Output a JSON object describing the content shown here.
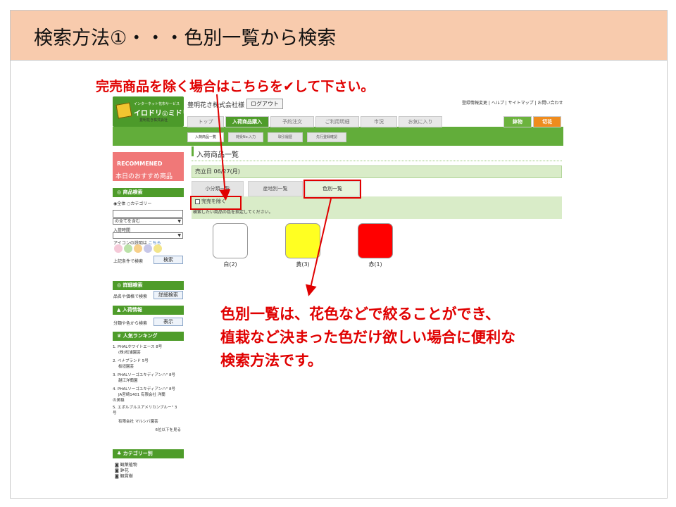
{
  "slide": {
    "title": "検索方法①・・・色別一覧から検索",
    "callout_top": "完売商品を除く場合はこちらを✔して下さい。",
    "callout_bottom_lines": [
      "色別一覧は、花色などで絞ることができ、",
      "植栽など決まった色だけ欲しい場合に便利な",
      "検索方法です。"
    ]
  },
  "header": {
    "logo_line1": "インターネット花市サービス",
    "logo_line2": "イロドリ◎ミドリ",
    "logo_line3": "豊明花き株式会社",
    "user": "豊明花き株式会社様",
    "logout": "ログアウト",
    "links": "登録情報変更 | ヘルプ | サイトマップ | お問い合わせ"
  },
  "nav": {
    "tabs": [
      "トップ",
      "入荷商品購入",
      "予約注文",
      "ご利用明細",
      "市況",
      "お気に入り"
    ],
    "right_tabs": [
      "鉢物",
      "切花"
    ]
  },
  "subnav": {
    "tabs": [
      "入荷商品一覧",
      "荷受No.入力",
      "取引履歴",
      "先行登録確認"
    ]
  },
  "sidebar": {
    "reco_top": "RECOMMENED",
    "reco_bottom": "本日のおすすめ商品",
    "search_head": "商品検索",
    "radio_all": "全体",
    "radio_cat": "カテゴリー",
    "select1": "の全てを含む",
    "arrival_label": "入荷時間",
    "icon_desc": "アイコンの説明は",
    "icon_link": "こちら",
    "search_cond": "上記条件で検索",
    "search_btn": "検索",
    "detail_head": "詳細検索",
    "detail_text": "品名や価格で検索",
    "detail_btn": "詳細検索",
    "arrival_head": "入荷情報",
    "arrival_text": "分類や色から検索",
    "arrival_btn": "表示",
    "rank_head": "人気ランキング",
    "ranking": [
      "1. PHALホワイトエース 8号",
      "(株)松浦園芸",
      "2. ベナプランド 5号",
      "板垣園芸",
      "3. PHALソーゴユキディアンハ\" 8号",
      "越江洋蘭園",
      "4. PHALソーゴユキディアンハ\" 8号",
      "JA宮崎1401 有限会社 洋蘭",
      "の美稲",
      "5. エポルブルスアメリカンブルー\" 3",
      "号",
      "有限会社 マルシバ園芸",
      "6位以下を見る"
    ],
    "cat_head": "カテゴリー別",
    "categories": [
      "観葉植物",
      "鉢花",
      "観賞樹"
    ]
  },
  "main": {
    "title": "入荷商品一覧",
    "date": "売立日 06/27(月)",
    "tabs": [
      "小分類一覧",
      "産地別一覧",
      "色別一覧"
    ],
    "sold_out_check": "完売を除く",
    "hint": "検索したい商品の色を指定してください。",
    "colors": [
      {
        "label": "白(2)",
        "hex": "#ffffff"
      },
      {
        "label": "黄(3)",
        "hex": "#ffff22"
      },
      {
        "label": "赤(1)",
        "hex": "#ff0000"
      }
    ]
  },
  "accent": {
    "callout": "#e00000",
    "header": "#f8cbad",
    "nav": "#62ad3a"
  }
}
